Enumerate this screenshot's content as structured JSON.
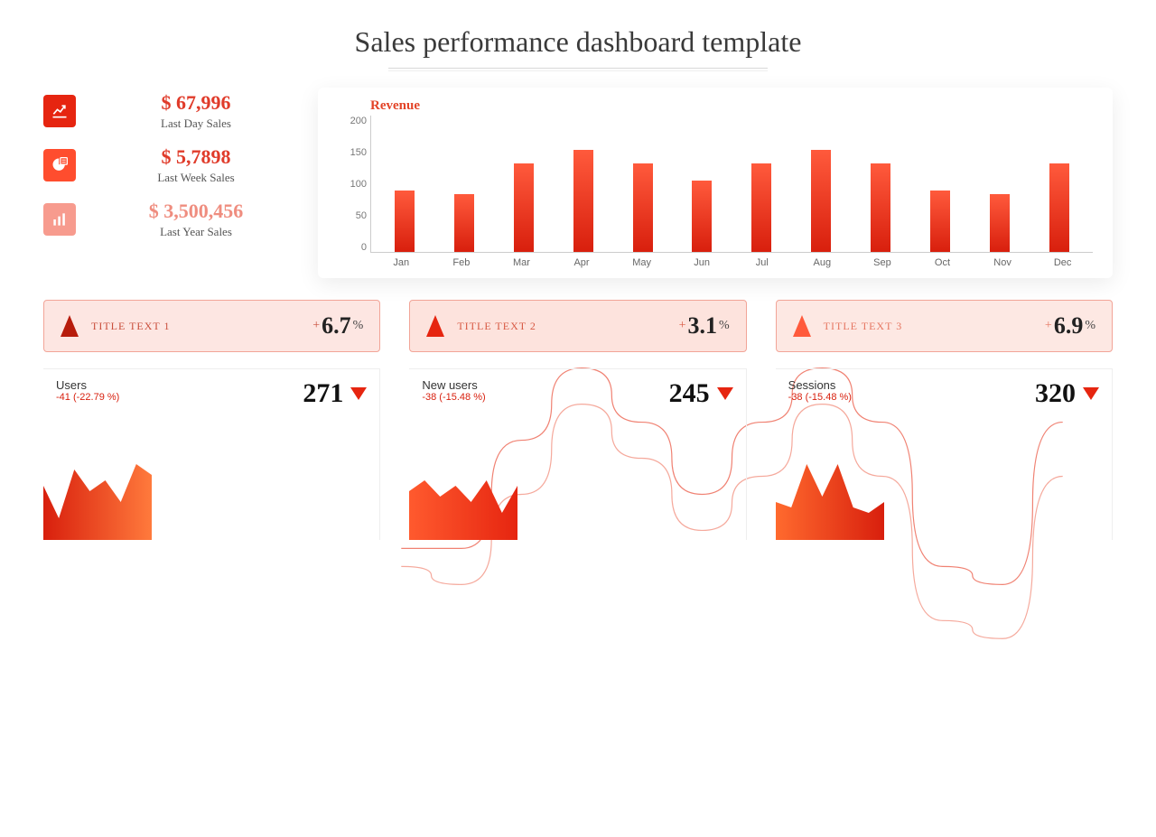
{
  "title": "Sales performance dashboard template",
  "stats": [
    {
      "icon": "chart-line-up-icon",
      "color": "#e62510",
      "value": "$ 67,996",
      "label": "Last Day Sales",
      "light": false
    },
    {
      "icon": "pie-calc-icon",
      "color": "#ff4d2e",
      "value": "$ 5,7898",
      "label": "Last Week Sales",
      "light": false
    },
    {
      "icon": "bar-chart-icon",
      "color": "#f79b8e",
      "value": "$ 3,500,456",
      "label": "Last Year Sales",
      "light": true
    }
  ],
  "chart_data": {
    "type": "bar",
    "title": "Revenue",
    "xlabel": "",
    "ylabel": "",
    "ylim": [
      0,
      200
    ],
    "yticks": [
      0,
      50,
      100,
      150,
      200
    ],
    "categories": [
      "Jan",
      "Feb",
      "Mar",
      "Apr",
      "May",
      "Jun",
      "Jul",
      "Aug",
      "Sep",
      "Oct",
      "Nov",
      "Dec"
    ],
    "values": [
      90,
      85,
      130,
      150,
      130,
      105,
      130,
      150,
      130,
      90,
      85,
      130
    ],
    "overlays": [
      {
        "type": "line",
        "name": "trend-a",
        "values": [
          80,
          80,
          110,
          130,
          115,
          95,
          115,
          130,
          115,
          75,
          70,
          115
        ]
      },
      {
        "type": "line",
        "name": "trend-b",
        "values": [
          75,
          70,
          95,
          120,
          105,
          85,
          100,
          120,
          100,
          60,
          55,
          100
        ]
      }
    ]
  },
  "title_cards": [
    {
      "label": "TITLE TEXT 1",
      "value": "6.7",
      "suffix": "%",
      "prefix": "+",
      "bg": "#fde6e2",
      "border": "#f2a598",
      "tri": "#b71c0c",
      "text": "#c94f3c"
    },
    {
      "label": "TITLE TEXT 2",
      "value": "3.1",
      "suffix": "%",
      "prefix": "+",
      "bg": "#fde3dd",
      "border": "#f2a598",
      "tri": "#e62510",
      "text": "#d85a44"
    },
    {
      "label": "TITLE TEXT 3",
      "value": "6.9",
      "suffix": "%",
      "prefix": "+",
      "bg": "#fde8e3",
      "border": "#f2a598",
      "tri": "#ff5a3c",
      "text": "#e67863"
    }
  ],
  "mini": [
    {
      "title": "Users",
      "delta": "-41 (-22.79 %)",
      "value": "271",
      "grad_from": "#d81f0d",
      "grad_to": "#ff7a3c",
      "shape": [
        50,
        20,
        65,
        45,
        55,
        35,
        70,
        60
      ]
    },
    {
      "title": "New users",
      "delta": "-38 (-15.48 %)",
      "value": "245",
      "grad_from": "#ff5a2e",
      "grad_to": "#e62510",
      "shape": [
        45,
        55,
        40,
        50,
        35,
        55,
        25,
        50
      ]
    },
    {
      "title": "Sessions",
      "delta": "-38 (-15.48 %)",
      "value": "320",
      "grad_from": "#ff6a2e",
      "grad_to": "#d81f0d",
      "shape": [
        35,
        30,
        70,
        40,
        70,
        30,
        25,
        35
      ]
    }
  ]
}
